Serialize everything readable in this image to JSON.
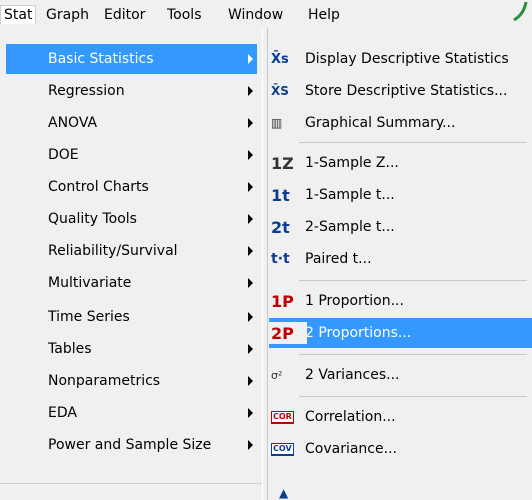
{
  "menubar": {
    "items": [
      "Stat",
      "Graph",
      "Editor",
      "Tools",
      "Window",
      "Help"
    ]
  },
  "stat_menu": {
    "items": [
      {
        "label": "Basic Statistics"
      },
      {
        "label": "Regression"
      },
      {
        "label": "ANOVA"
      },
      {
        "label": "DOE"
      },
      {
        "label": "Control Charts"
      },
      {
        "label": "Quality Tools"
      },
      {
        "label": "Reliability/Survival"
      },
      {
        "label": "Multivariate"
      },
      {
        "label": "Time Series"
      },
      {
        "label": "Tables"
      },
      {
        "label": "Nonparametrics"
      },
      {
        "label": "EDA"
      },
      {
        "label": "Power and Sample Size"
      }
    ],
    "selected": "Basic Statistics"
  },
  "basic_stats_menu": {
    "items": [
      {
        "label": "Display Descriptive Statistics",
        "icon": "descriptive-stats-icon",
        "glyph": "X̄s"
      },
      {
        "label": "Store Descriptive Statistics...",
        "icon": "store-stats-icon",
        "glyph": "X̄S"
      },
      {
        "label": "Graphical Summary...",
        "icon": "graphical-summary-icon",
        "glyph": "▥"
      },
      {
        "label": "1-Sample Z...",
        "icon": "one-sample-z-icon",
        "glyph": "1Z"
      },
      {
        "label": "1-Sample t...",
        "icon": "one-sample-t-icon",
        "glyph": "1t"
      },
      {
        "label": "2-Sample t...",
        "icon": "two-sample-t-icon",
        "glyph": "2t"
      },
      {
        "label": "Paired t...",
        "icon": "paired-t-icon",
        "glyph": "t·t"
      },
      {
        "label": "1 Proportion...",
        "icon": "one-proportion-icon",
        "glyph": "1P"
      },
      {
        "label": "2 Proportions...",
        "icon": "two-proportions-icon",
        "glyph": "2P"
      },
      {
        "label": "2 Variances...",
        "icon": "two-variances-icon",
        "glyph": "σ²"
      },
      {
        "label": "Correlation...",
        "icon": "correlation-icon",
        "glyph": "COR"
      },
      {
        "label": "Covariance...",
        "icon": "covariance-icon",
        "glyph": "COV"
      }
    ],
    "selected": "2 Proportions..."
  },
  "colors": {
    "highlight": "#3399ff",
    "menu_bg": "#f0f0f0",
    "icon_blue": "#0b3d91",
    "icon_red": "#c00000"
  }
}
